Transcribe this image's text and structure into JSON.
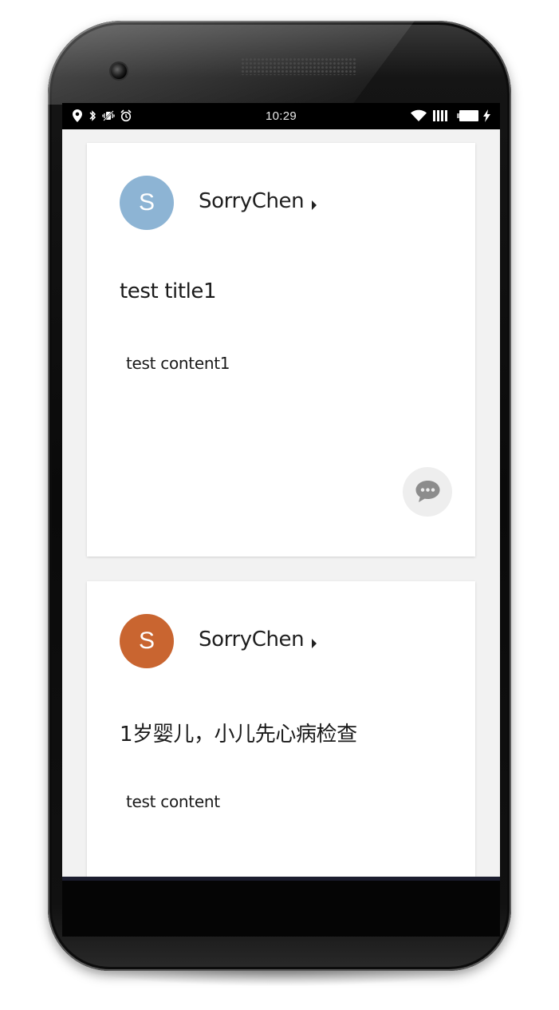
{
  "status_bar": {
    "time": "10:29",
    "left_icons": [
      "location-icon",
      "bluetooth-icon",
      "vibrate-icon",
      "alarm-icon"
    ],
    "right_icons": [
      "wifi-icon",
      "signal-icon",
      "battery-icon",
      "charging-icon"
    ]
  },
  "posts": [
    {
      "avatar_letter": "S",
      "avatar_color": "#8db4d4",
      "author": "SorryChen",
      "title": "test title1",
      "content": "test content1",
      "action_icon": "comment-icon"
    },
    {
      "avatar_letter": "S",
      "avatar_color": "#c96530",
      "author": "SorryChen",
      "title": "1岁婴儿，小儿先心病检查",
      "content": "test content"
    }
  ],
  "colors": {
    "screen_background": "#f2f2f2",
    "card_background": "#ffffff",
    "status_bar": "#000000",
    "icon_gray": "#8c8c8c"
  }
}
